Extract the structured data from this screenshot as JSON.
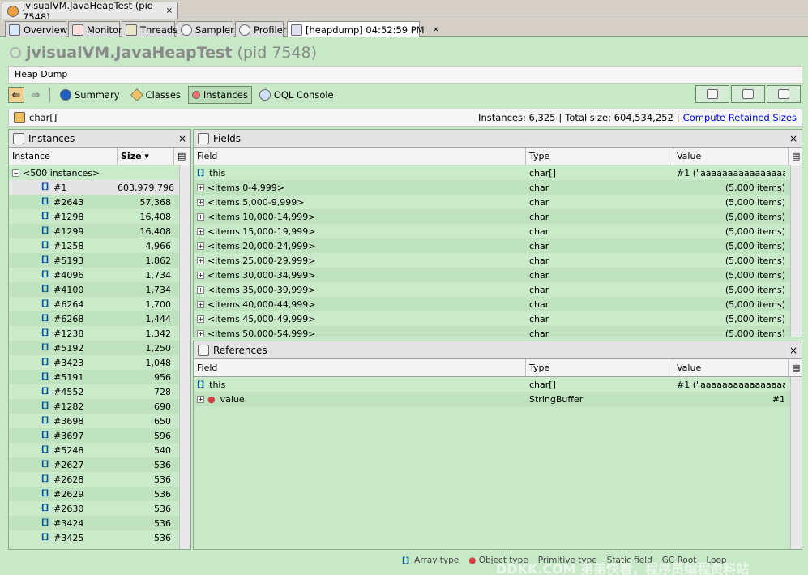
{
  "window_tab": {
    "title": "jvisualVM.JavaHeapTest (pid 7548)",
    "close": "×"
  },
  "sub_tabs": [
    {
      "label": "Overview",
      "icon": "overview-icon"
    },
    {
      "label": "Monitor",
      "icon": "monitor-icon"
    },
    {
      "label": "Threads",
      "icon": "threads-icon"
    },
    {
      "label": "Sampler",
      "icon": "sampler-icon"
    },
    {
      "label": "Profiler",
      "icon": "profiler-icon"
    },
    {
      "label": "[heapdump] 04:52:59 PM",
      "icon": "heapdump-icon",
      "close": "×"
    }
  ],
  "app_title": {
    "name": "jvisualVM.JavaHeapTest",
    "pid": "(pid 7548)"
  },
  "heap_dump_label": "Heap Dump",
  "toolbar": {
    "summary": "Summary",
    "classes": "Classes",
    "instances": "Instances",
    "oql": "OQL Console"
  },
  "class_bar": {
    "class_name": "char[]",
    "instances": "Instances: 6,325",
    "sep1": "|",
    "total_size": "Total size: 604,534,252",
    "sep2": "|",
    "compute_link": "Compute Retained Sizes"
  },
  "instances_panel": {
    "title": "Instances",
    "close": "×",
    "col_instance": "Instance",
    "col_size": "Size",
    "group_label": "<500 instances>",
    "rows": [
      {
        "id": "#1",
        "size": "603,979,796"
      },
      {
        "id": "#2643",
        "size": "57,368"
      },
      {
        "id": "#1298",
        "size": "16,408"
      },
      {
        "id": "#1299",
        "size": "16,408"
      },
      {
        "id": "#1258",
        "size": "4,966"
      },
      {
        "id": "#5193",
        "size": "1,862"
      },
      {
        "id": "#4096",
        "size": "1,734"
      },
      {
        "id": "#4100",
        "size": "1,734"
      },
      {
        "id": "#6264",
        "size": "1,700"
      },
      {
        "id": "#6268",
        "size": "1,444"
      },
      {
        "id": "#1238",
        "size": "1,342"
      },
      {
        "id": "#5192",
        "size": "1,250"
      },
      {
        "id": "#3423",
        "size": "1,048"
      },
      {
        "id": "#5191",
        "size": "956"
      },
      {
        "id": "#4552",
        "size": "728"
      },
      {
        "id": "#1282",
        "size": "690"
      },
      {
        "id": "#3698",
        "size": "650"
      },
      {
        "id": "#3697",
        "size": "596"
      },
      {
        "id": "#5248",
        "size": "540"
      },
      {
        "id": "#2627",
        "size": "536"
      },
      {
        "id": "#2628",
        "size": "536"
      },
      {
        "id": "#2629",
        "size": "536"
      },
      {
        "id": "#2630",
        "size": "536"
      },
      {
        "id": "#3424",
        "size": "536"
      },
      {
        "id": "#3425",
        "size": "536"
      }
    ]
  },
  "fields_panel": {
    "title": "Fields",
    "close": "×",
    "col_field": "Field",
    "col_type": "Type",
    "col_value": "Value",
    "rows": [
      {
        "field": "this",
        "type": "char[]",
        "value": "#1 (\"aaaaaaaaaaaaaaaaa...",
        "kind": "this"
      },
      {
        "field": "<items 0-4,999>",
        "type": "char",
        "value": "(5,000 items)",
        "kind": "group"
      },
      {
        "field": "<items 5,000-9,999>",
        "type": "char",
        "value": "(5,000 items)",
        "kind": "group"
      },
      {
        "field": "<items 10,000-14,999>",
        "type": "char",
        "value": "(5,000 items)",
        "kind": "group"
      },
      {
        "field": "<items 15,000-19,999>",
        "type": "char",
        "value": "(5,000 items)",
        "kind": "group"
      },
      {
        "field": "<items 20,000-24,999>",
        "type": "char",
        "value": "(5,000 items)",
        "kind": "group"
      },
      {
        "field": "<items 25,000-29,999>",
        "type": "char",
        "value": "(5,000 items)",
        "kind": "group"
      },
      {
        "field": "<items 30,000-34,999>",
        "type": "char",
        "value": "(5,000 items)",
        "kind": "group"
      },
      {
        "field": "<items 35,000-39,999>",
        "type": "char",
        "value": "(5,000 items)",
        "kind": "group"
      },
      {
        "field": "<items 40,000-44,999>",
        "type": "char",
        "value": "(5,000 items)",
        "kind": "group"
      },
      {
        "field": "<items 45,000-49,999>",
        "type": "char",
        "value": "(5,000 items)",
        "kind": "group"
      },
      {
        "field": "<items 50,000-54,999>",
        "type": "char",
        "value": "(5,000 items)",
        "kind": "group"
      }
    ]
  },
  "references_panel": {
    "title": "References",
    "close": "×",
    "col_field": "Field",
    "col_type": "Type",
    "col_value": "Value",
    "rows": [
      {
        "field": "this",
        "type": "char[]",
        "value": "#1 (\"aaaaaaaaaaaaaaaaa...",
        "kind": "this"
      },
      {
        "field": "value",
        "type": "StringBuffer",
        "value": "#1",
        "kind": "ref"
      }
    ]
  },
  "legend": {
    "array_type": "Array type",
    "object_type": "Object type",
    "primitive_type": "Primitive type",
    "static_field": "Static field",
    "gc_root": "GC Root",
    "loop": "Loop"
  },
  "watermark": "DDKK.COM 弟弟快看，程序员编程资料站",
  "colors": {
    "panel_bg": "#c7e9c7",
    "link": "#0000ee"
  }
}
